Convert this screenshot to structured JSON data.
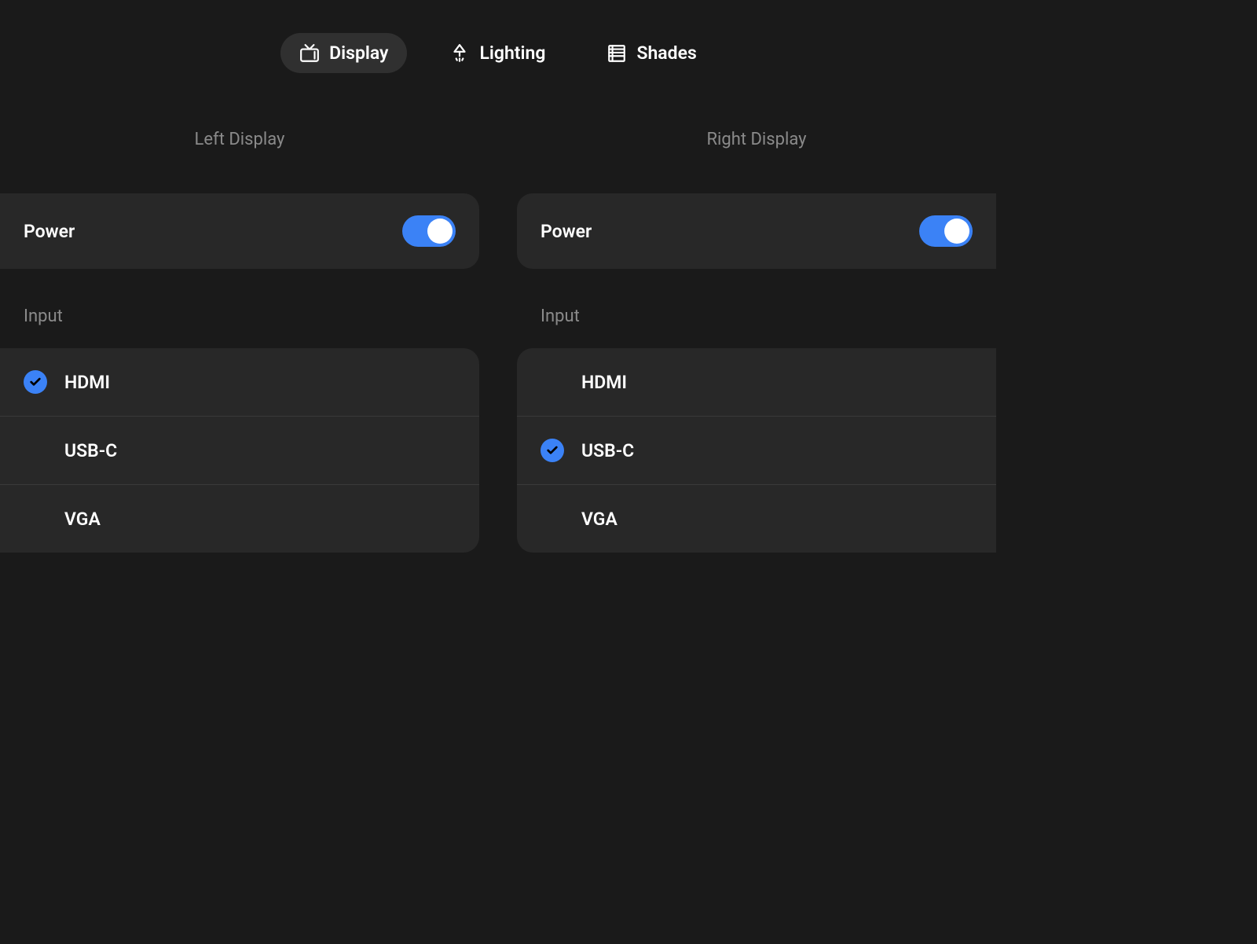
{
  "tabs": [
    {
      "label": "Display",
      "icon": "tv",
      "active": true
    },
    {
      "label": "Lighting",
      "icon": "lamp",
      "active": false
    },
    {
      "label": "Shades",
      "icon": "blinds",
      "active": false
    }
  ],
  "columns": [
    {
      "title": "Left Display",
      "power": {
        "label": "Power",
        "on": true
      },
      "input_label": "Input",
      "inputs": [
        {
          "label": "HDMI",
          "selected": true
        },
        {
          "label": "USB-C",
          "selected": false
        },
        {
          "label": "VGA",
          "selected": false
        }
      ]
    },
    {
      "title": "Right Display",
      "power": {
        "label": "Power",
        "on": true
      },
      "input_label": "Input",
      "inputs": [
        {
          "label": "HDMI",
          "selected": false
        },
        {
          "label": "USB-C",
          "selected": true
        },
        {
          "label": "VGA",
          "selected": false
        }
      ]
    }
  ],
  "colors": {
    "accent": "#3b82f6",
    "bg": "#1a1a1a",
    "card": "#282828",
    "muted": "#8a8a8a"
  }
}
